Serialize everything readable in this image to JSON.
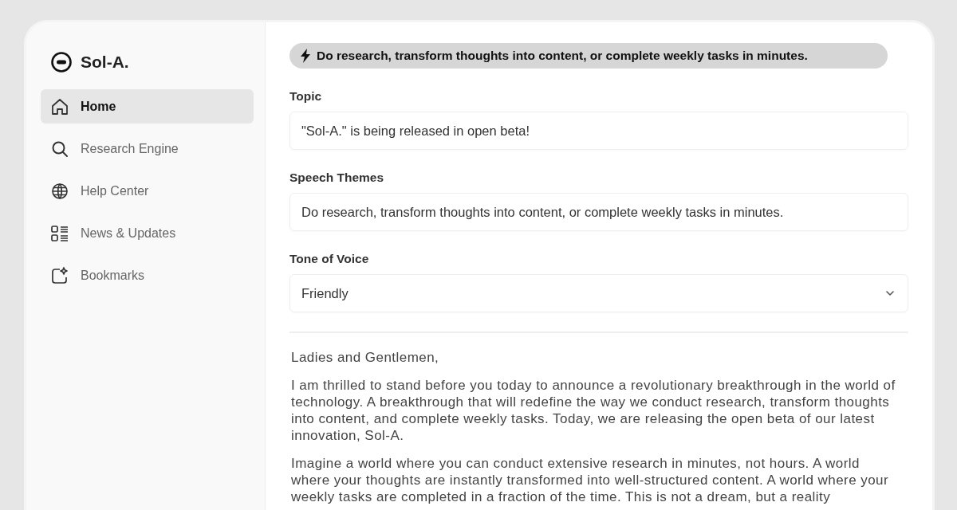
{
  "brand": {
    "name": "Sol-A."
  },
  "sidebar": {
    "items": [
      {
        "label": "Home",
        "selected": true
      },
      {
        "label": "Research Engine",
        "selected": false
      },
      {
        "label": "Help Center",
        "selected": false
      },
      {
        "label": "News & Updates",
        "selected": false
      },
      {
        "label": "Bookmarks",
        "selected": false
      }
    ]
  },
  "banner": {
    "text": "Do research, transform thoughts into content, or complete weekly tasks in minutes."
  },
  "form": {
    "fields": [
      {
        "kind": "text",
        "label": "Topic",
        "value": "\"Sol-A.\" is being released in open beta!"
      },
      {
        "kind": "text",
        "label": "Speech Themes",
        "value": "Do research, transform thoughts into content, or complete weekly tasks in minutes."
      },
      {
        "kind": "select",
        "label": "Tone of Voice",
        "value": "Friendly"
      }
    ]
  },
  "output": {
    "paragraphs": [
      "Ladies and Gentlemen,",
      "I am thrilled to stand before you today to announce a revolutionary breakthrough in the world of technology. A breakthrough that will redefine the way we conduct research, transform thoughts into content, and complete weekly tasks. Today, we are releasing the open beta of our latest innovation, Sol-A.",
      "Imagine a world where you can conduct extensive research in minutes, not hours. A world where your thoughts are instantly transformed into well-structured content. A world where your weekly tasks are completed in a fraction of the time. This is not a dream, but a reality"
    ]
  }
}
